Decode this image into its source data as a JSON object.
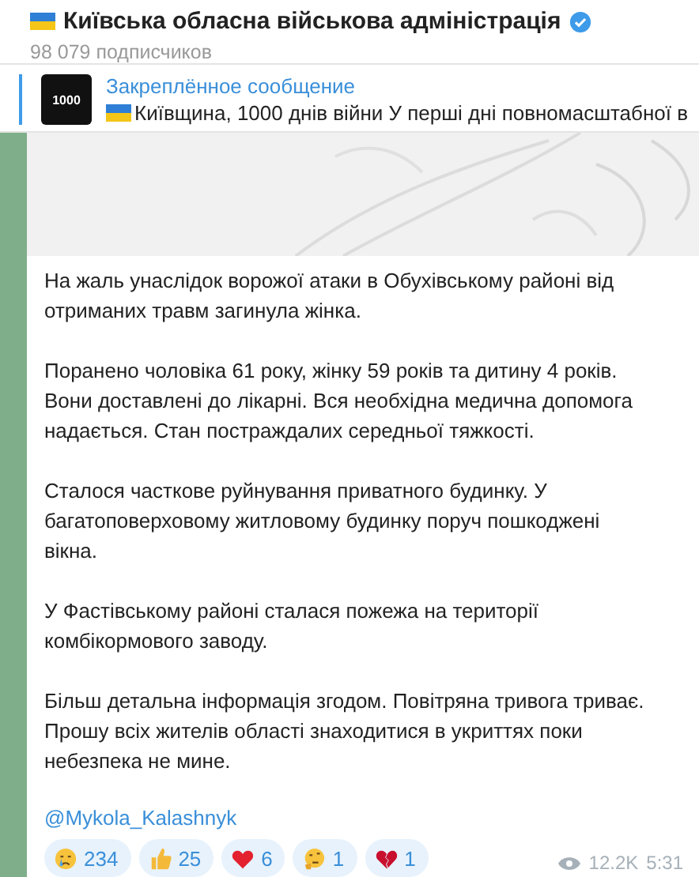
{
  "channel": {
    "title": "Київська обласна військова адміністрація",
    "verified": true,
    "subscribers": "98 079 подписчиков"
  },
  "pinned": {
    "label": "Закреплённое сообщение",
    "thumbnail_text": "1000",
    "text": "Київщина, 1000 днів війни  У перші дні повномасштабної в"
  },
  "message": {
    "paragraphs": [
      "На жаль унаслідок ворожої атаки в Обухівському районі від\nотриманих травм загинула жінка.",
      "Поранено чоловіка 61 року, жінку 59 років та дитину 4 років.\nВони доставлені до лікарні. Вся необхідна медична допомога\nнадається. Стан постраждалих середньої тяжкості.",
      "Сталося часткове руйнування приватного будинку. У\nбагатоповерховому житловому будинку поруч пошкоджені\nвікна.",
      "У Фастівському районі сталася пожежа на території\nкомбікормового заводу.",
      "Більш детальна інформація згодом. Повітряна тривога триває.\nПрошу всіх жителів області знаходитися в укриттях поки\nнебезпека не мине."
    ],
    "signature": "@Mykola_Kalashnyk",
    "reactions": [
      {
        "kind": "crying",
        "count": "234"
      },
      {
        "kind": "thumbs_up",
        "count": "25"
      },
      {
        "kind": "heart",
        "count": "6"
      },
      {
        "kind": "thinking",
        "count": "1"
      },
      {
        "kind": "broken_heart",
        "count": "1"
      }
    ],
    "views": "12.2K",
    "time": "5:31"
  }
}
